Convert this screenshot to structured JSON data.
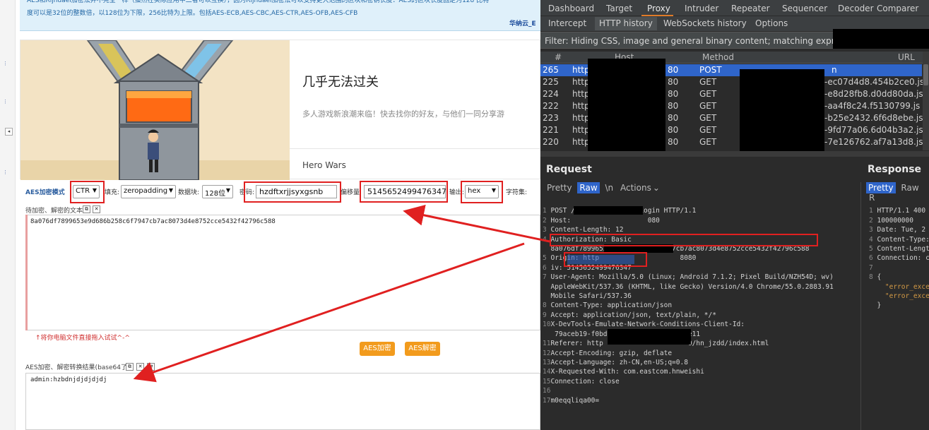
{
  "left": {
    "info_line1": "AES和Rijndael加密法并不完全一样（虽然在实际应用中二者可以互换），因为Rijndael加密法可以支持更大范围的区块和密钥长度：AES的区块长度固定为128 比特",
    "info_line2": "度可以是32位的整数倍，以128位为下限，256比特为上限。包括AES-ECB,AES-CBC,AES-CTR,AES-OFB,AES-CFB",
    "info_brand": "华纳云_E",
    "ad_title": "几乎无法过关",
    "ad_subtitle": "多人游戏新浪潮来临！快去找你的好友，与他们一同分享游",
    "ad_brand": "Hero Wars",
    "mode_label": "AES加密模式",
    "mode_value": "CTR",
    "padding_label": "填充:",
    "padding_value": "zeropadding",
    "block_label": "数据块:",
    "block_value": "128位",
    "password_label": "密码:",
    "password_value": "hzdftxrjjsyxgsnb",
    "offset_label": "偏移量:",
    "offset_value": "5145652499476347",
    "output_label": "输出:",
    "output_value": "hex",
    "charset_label": "字符集:",
    "input_area_label": "待加密、解密的文本:",
    "input_text": "8a076df7899653e9d686b258c6f7947cb7ac8073d4e8752cce5432f42796c588",
    "drag_hint": "↑将你电脑文件直接拖入试试^-^",
    "encrypt_button": "AES加密",
    "decrypt_button": "AES解密",
    "result_label": "AES加密、解密转换结果(base64了):",
    "result_text": "admin:hzbdnjdjdjdjdj"
  },
  "burp": {
    "menu": [
      "Dashboard",
      "Target",
      "Proxy",
      "Intruder",
      "Repeater",
      "Sequencer",
      "Decoder",
      "Comparer"
    ],
    "active_menu": "Proxy",
    "subtabs": [
      "Intercept",
      "HTTP history",
      "WebSockets history",
      "Options"
    ],
    "active_subtab": "HTTP history",
    "filter_text": "Filter: Hiding CSS, image and general binary content;  matching expression",
    "columns": [
      "#",
      "Host",
      "Method",
      "URL"
    ],
    "rows": [
      {
        "num": "265",
        "host": "http",
        "port": "80",
        "method": "POST",
        "url": "n"
      },
      {
        "num": "225",
        "host": "http",
        "port": "80",
        "method": "GET",
        "url": "-ec07d4d8.454b2ce0.js"
      },
      {
        "num": "224",
        "host": "http",
        "port": "80",
        "method": "GET",
        "url": "-e8d28fb8.d0dd80da.js"
      },
      {
        "num": "222",
        "host": "http",
        "port": "80",
        "method": "GET",
        "url": "-aa4f8c24.f5130799.js"
      },
      {
        "num": "223",
        "host": "http",
        "port": "80",
        "method": "GET",
        "url": "-b25e2432.6f6d8ebe.js"
      },
      {
        "num": "221",
        "host": "http",
        "port": "80",
        "method": "GET",
        "url": "-9fd77a06.6d04b3a2.js"
      },
      {
        "num": "220",
        "host": "http",
        "port": "80",
        "method": "GET",
        "url": "-7e126762.af7a13d8.js"
      }
    ],
    "request_title": "Request",
    "response_title": "Response",
    "request_tabs": [
      "Pretty",
      "Raw",
      "\\n",
      "Actions"
    ],
    "active_request_tab": "Raw",
    "response_tabs": [
      "Pretty",
      "Raw",
      "R"
    ],
    "active_response_tab": "Pretty",
    "request_lines": [
      {
        "n": "1",
        "t": "POST /systemws/app/appLogin HTTP/1.1"
      },
      {
        "n": "2",
        "t": "Host:                   080"
      },
      {
        "n": "3",
        "t": "Content-Length: 12"
      },
      {
        "n": "4",
        "t": "Authorization: Basic"
      },
      {
        "n": "",
        "t": "8a076df7899653e9d686b258c6f7947cb7ac8073d4e8752cce5432f42796c588"
      },
      {
        "n": "5",
        "t": "Origin: http                    8080"
      },
      {
        "n": "6",
        "t": "iv: 5145652499476347"
      },
      {
        "n": "7",
        "t": "User-Agent: Mozilla/5.0 (Linux; Android 7.1.2; Pixel Build/NZH54D; wv)"
      },
      {
        "n": "",
        "t": "AppleWebKit/537.36 (KHTML, like Gecko) Version/4.0 Chrome/55.0.2883.91"
      },
      {
        "n": "",
        "t": "Mobile Safari/537.36"
      },
      {
        "n": "8",
        "t": "Content-Type: application/json"
      },
      {
        "n": "9",
        "t": "Accept: application/json, text/plain, */*"
      },
      {
        "n": "10",
        "t": "X-DevTools-Emulate-Network-Conditions-Client-Id:"
      },
      {
        "n": "",
        "t": "79aceb19-f0bd-4991-970e-009c0434fe11"
      },
      {
        "n": "11",
        "t": "Referer: http                     0/hn_jzdd/index.html"
      },
      {
        "n": "12",
        "t": "Accept-Encoding: gzip, deflate"
      },
      {
        "n": "13",
        "t": "Accept-Language: zh-CN,en-US;q=0.8"
      },
      {
        "n": "14",
        "t": "X-Requested-With: com.eastcom.hnweishi"
      },
      {
        "n": "15",
        "t": "Connection: close"
      },
      {
        "n": "16",
        "t": ""
      },
      {
        "n": "17",
        "t": "m0eqqliqa00="
      }
    ],
    "response_lines": [
      {
        "n": "1",
        "t": "HTTP/1.1 400"
      },
      {
        "n": "2",
        "t": "100000000"
      },
      {
        "n": "3",
        "t": "Date: Tue, 2"
      },
      {
        "n": "4",
        "t": "Content-Type:"
      },
      {
        "n": "5",
        "t": "Content-Lengt"
      },
      {
        "n": "6",
        "t": "Connection: c"
      },
      {
        "n": "7",
        "t": ""
      },
      {
        "n": "8",
        "t": "{"
      },
      {
        "n": "",
        "t": "  \"error_exce"
      },
      {
        "n": "",
        "t": "  \"error_exce"
      },
      {
        "n": "",
        "t": "}"
      }
    ]
  }
}
